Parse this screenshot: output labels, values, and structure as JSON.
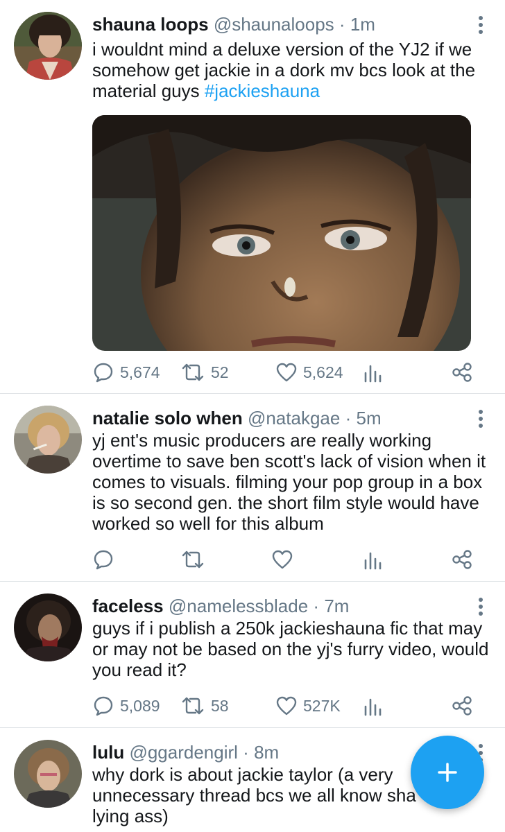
{
  "tweets": [
    {
      "name": "shauna loops",
      "handle": "@shaunaloops",
      "sep": "·",
      "time": "1m",
      "text": "i wouldnt mind a deluxe version of the YJ2 if we somehow get jackie in a dork mv bcs look at the material guys ",
      "hashtag": "#jackieshauna",
      "replies": "5,674",
      "retweets": "52",
      "likes": "5,624"
    },
    {
      "name": "natalie solo when",
      "handle": "@natakgae",
      "sep": "·",
      "time": "5m",
      "text": "yj ent's music producers are really working overtime to save ben scott's lack of vision when it comes to visuals. filming your pop group in a box is so second gen. the short film style would have worked so well for this album",
      "replies": "",
      "retweets": "",
      "likes": ""
    },
    {
      "name": "faceless",
      "handle": "@namelessblade",
      "sep": "·",
      "time": "7m",
      "text": "guys if i publish a 250k jackieshauna fic that may or may not be based on the yj's furry video, would you read it?",
      "replies": "5,089",
      "retweets": "58",
      "likes": "527K"
    },
    {
      "name": "lulu",
      "handle": "@ggardengirl",
      "sep": "·",
      "time": "8m",
      "text": "why dork is about jackie taylor (a very unnecessary thread bcs we all know sha",
      "text2": "lying ass)"
    }
  ],
  "colors": {
    "accent": "#1da1f2",
    "text": "#14171a",
    "muted": "#657786",
    "divider": "#dfe3e6"
  },
  "icons": [
    "reply-icon",
    "retweet-icon",
    "like-icon",
    "analytics-icon",
    "share-icon",
    "more-vert-icon",
    "compose-plus-icon"
  ]
}
